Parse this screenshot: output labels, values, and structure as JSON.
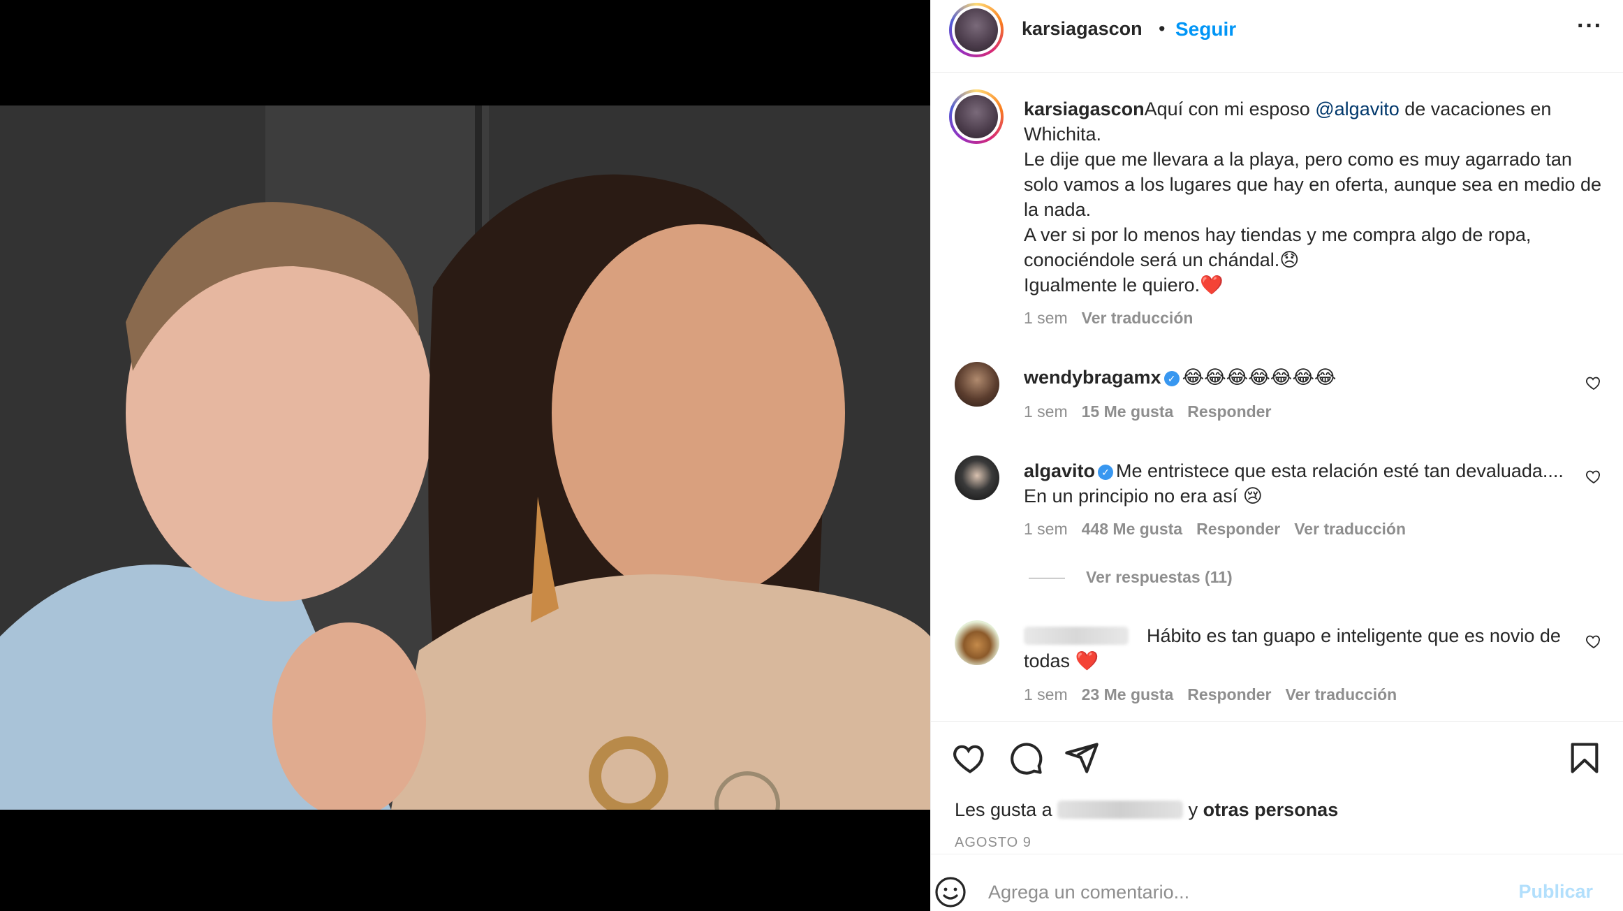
{
  "post": {
    "username": "karsiagascon",
    "follow_label": "Seguir",
    "more_label": "···",
    "caption_username": "karsiagascon",
    "caption_before_mention": "Aquí con mi esposo ",
    "caption_mention": "@algavito",
    "caption_after_mention": " de vacaciones en Whichita.",
    "caption_line2": "Le dije que me llevara a la playa, pero como es muy agarrado tan solo vamos a los lugares que hay en oferta, aunque sea en medio de la nada.",
    "caption_line3": "A ver si por lo menos hay tiendas y me compra algo de ropa, conociéndole será un chándal.😞",
    "caption_line4": "Igualmente le quiero.❤️",
    "caption_time": "1 sem",
    "caption_translate": "Ver traducción"
  },
  "comments": [
    {
      "username": "wendybragamx",
      "verified": true,
      "text": "😂😂😂😂😂😂😂",
      "time": "1 sem",
      "likes": "15 Me gusta",
      "reply": "Responder"
    },
    {
      "username": "algavito",
      "verified": true,
      "text": "Me entristece que esta relación esté tan devaluada.... En un principio no era así 😢",
      "time": "1 sem",
      "likes": "448 Me gusta",
      "reply": "Responder",
      "translate": "Ver traducción",
      "view_replies": "Ver respuestas (11)"
    },
    {
      "username": "",
      "verified": false,
      "text": "Hábito es tan guapo e inteligente que es novio de todas ❤️",
      "time": "1 sem",
      "likes": "23 Me gusta",
      "reply": "Responder",
      "translate": "Ver traducción"
    }
  ],
  "likes_line": {
    "prefix": "Les gusta a",
    "conjunction": " y ",
    "others": "otras personas"
  },
  "date": "AGOSTO 9",
  "comment_box": {
    "placeholder": "Agrega un comentario...",
    "publish_label": "Publicar"
  },
  "icons": [
    "heart-icon",
    "comment-icon",
    "share-icon",
    "bookmark-icon",
    "emoji-icon",
    "verified-icon",
    "more-icon"
  ],
  "colors": {
    "link_blue": "#0095f6",
    "mention": "#00376b",
    "muted": "#8e8e8e",
    "verified": "#3897f0",
    "publish_disabled": "#b2dffc"
  }
}
